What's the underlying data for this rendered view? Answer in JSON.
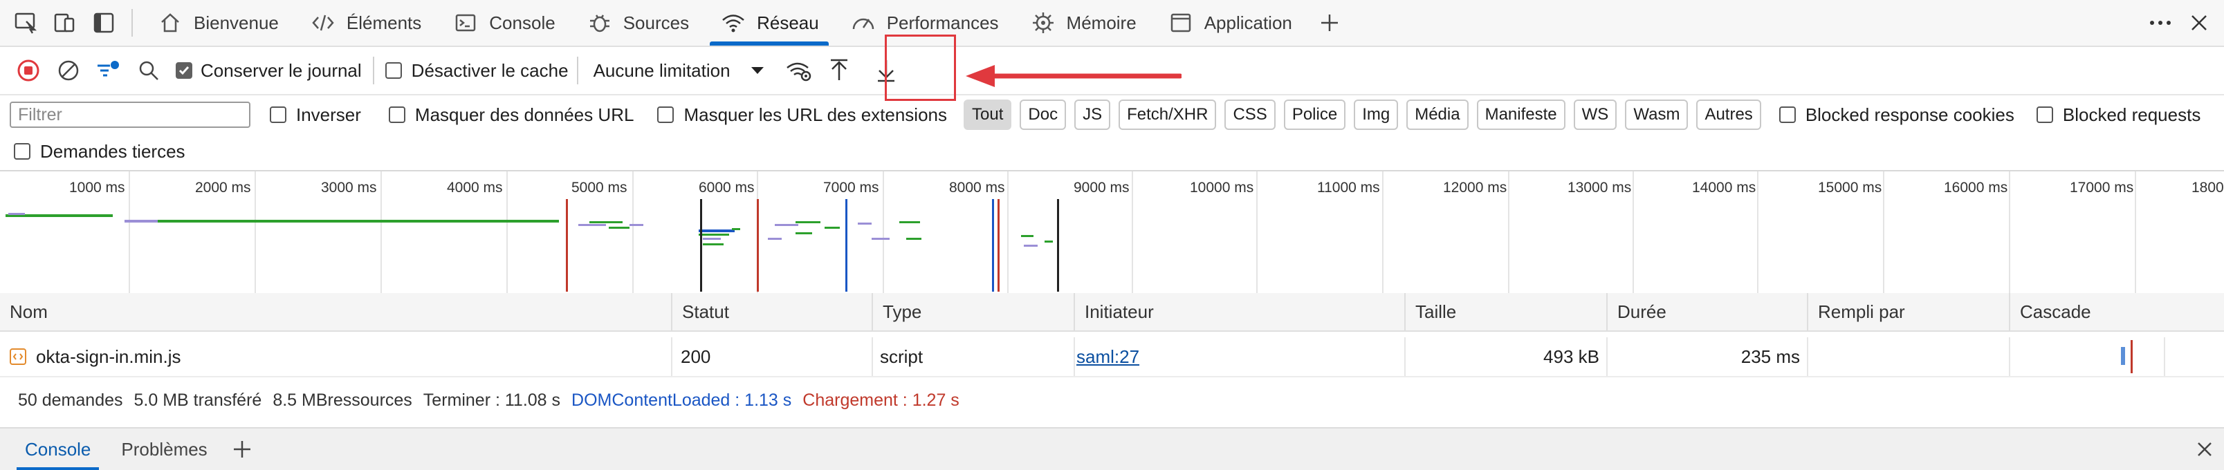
{
  "tabs": [
    {
      "label": "Bienvenue",
      "icon": "home-icon"
    },
    {
      "label": "Éléments",
      "icon": "code-icon"
    },
    {
      "label": "Console",
      "icon": "console-icon"
    },
    {
      "label": "Sources",
      "icon": "bug-icon"
    },
    {
      "label": "Réseau",
      "icon": "wifi-icon"
    },
    {
      "label": "Performances",
      "icon": "gauge-icon"
    },
    {
      "label": "Mémoire",
      "icon": "chip-icon"
    },
    {
      "label": "Application",
      "icon": "window-icon"
    }
  ],
  "active_tab": "Réseau",
  "toolbar": {
    "preserve_log": "Conserver le journal",
    "disable_cache": "Désactiver le cache",
    "throttling": "Aucune limitation"
  },
  "filter": {
    "placeholder": "Filtrer",
    "invert": "Inverser",
    "hide_data_urls": "Masquer des données URL",
    "hide_extension_urls": "Masquer les URL des extensions",
    "types": [
      "Tout",
      "Doc",
      "JS",
      "Fetch/XHR",
      "CSS",
      "Police",
      "Img",
      "Média",
      "Manifeste",
      "WS",
      "Wasm",
      "Autres"
    ],
    "blocked_cookies": "Blocked response cookies",
    "blocked_requests": "Blocked requests",
    "third_party": "Demandes tierces"
  },
  "overview_ticks": [
    "1000 ms",
    "2000 ms",
    "3000 ms",
    "4000 ms",
    "5000 ms",
    "6000 ms",
    "7000 ms",
    "8000 ms",
    "9000 ms",
    "10000 ms",
    "11000 ms",
    "12000 ms",
    "13000 ms",
    "14000 ms",
    "15000 ms",
    "16000 ms",
    "17000 ms",
    "1800"
  ],
  "table": {
    "headers": [
      "Nom",
      "Statut",
      "Type",
      "Initiateur",
      "Taille",
      "Durée",
      "Rempli par",
      "Cascade"
    ],
    "row": {
      "name": "okta-sign-in.min.js",
      "status": "200",
      "type": "script",
      "initiator": "saml:27",
      "size": "493 kB",
      "duration": "235 ms",
      "filled_by": ""
    }
  },
  "summary": {
    "requests": "50 demandes",
    "transferred": "5.0 MB transféré",
    "resources": "8.5 MBressources",
    "finish": "Terminer : 11.08 s",
    "dcl": "DOMContentLoaded : 1.13 s",
    "load": "Chargement : 1.27 s"
  },
  "drawer": {
    "tabs": [
      "Console",
      "Problèmes"
    ]
  },
  "colors": {
    "accent": "#0b6ac9",
    "annotation": "#e0393e",
    "dcl": "#1a56c4",
    "load": "#c0392b",
    "waiting": "#2ca02c"
  }
}
